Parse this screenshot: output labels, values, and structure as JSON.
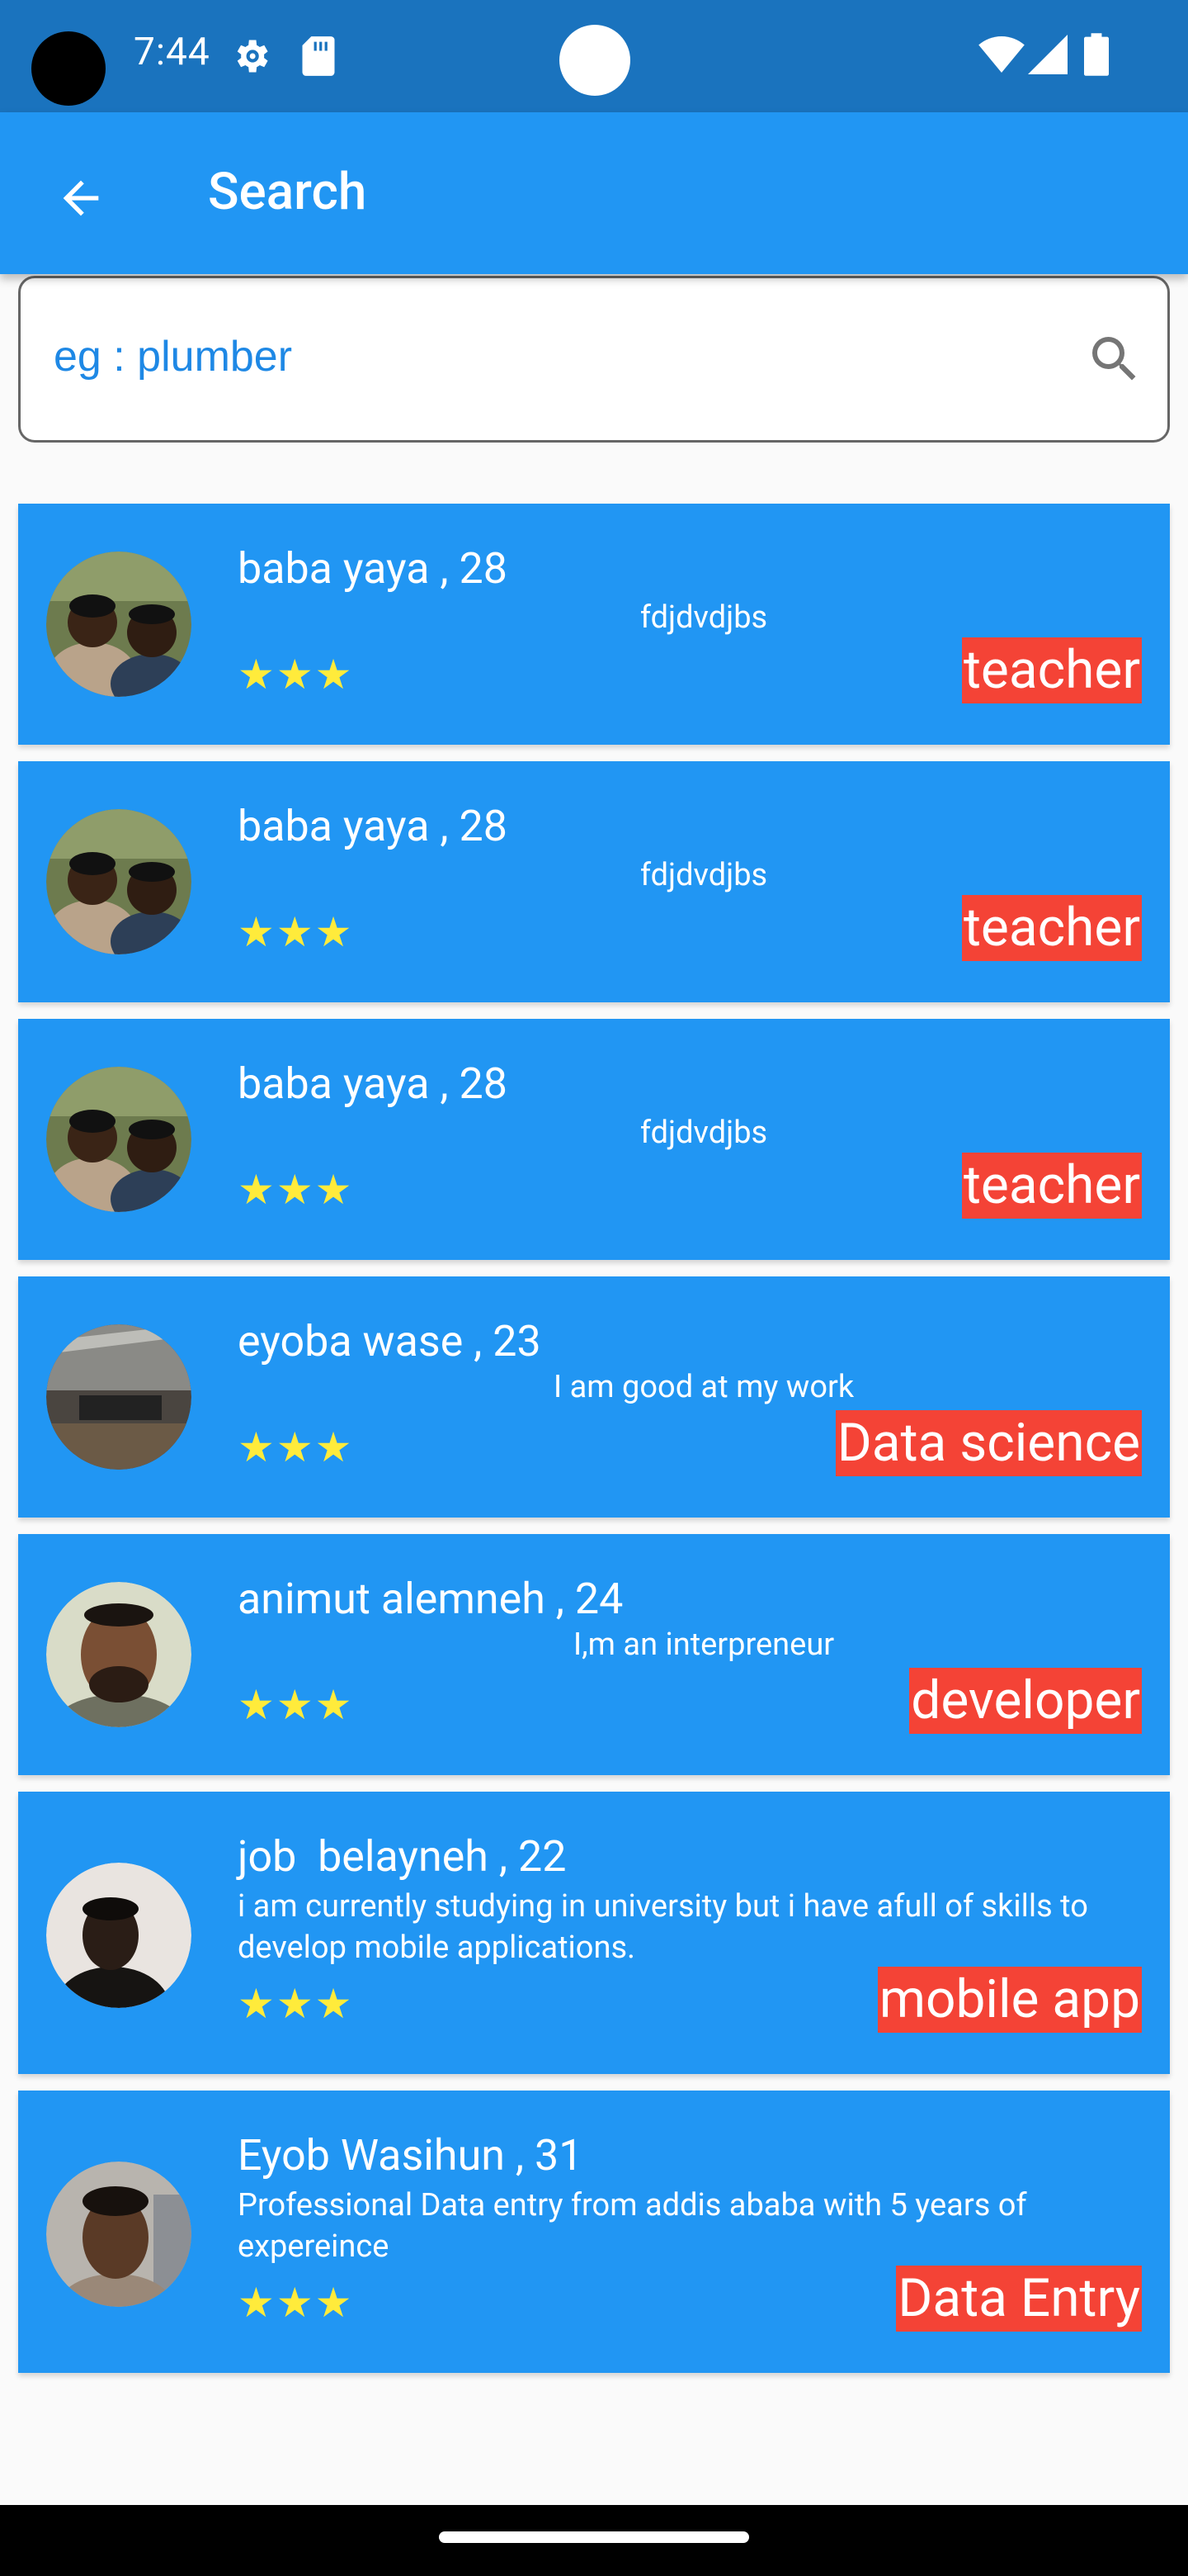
{
  "status_bar": {
    "time": "7:44",
    "icons": [
      "settings-icon",
      "sd-card-icon",
      "wifi-icon",
      "signal-icon",
      "battery-icon"
    ]
  },
  "app_bar": {
    "title": "Search",
    "back_icon": "arrow-back-icon"
  },
  "search": {
    "placeholder": "eg : plumber",
    "value": ""
  },
  "colors": {
    "status_bar": "#1a73be",
    "app_bar": "#2196f3",
    "card": "#2196f3",
    "tag": "#f44336",
    "stars": "#ffeb3b",
    "placeholder": "#1e88e5"
  },
  "results": [
    {
      "name": "baba yaya , 28",
      "description": "fdjdvdjbs",
      "rating": 3,
      "stars": "★★★",
      "profession": "teacher"
    },
    {
      "name": "baba yaya , 28",
      "description": "fdjdvdjbs",
      "rating": 3,
      "stars": "★★★",
      "profession": "teacher"
    },
    {
      "name": "baba yaya , 28",
      "description": "fdjdvdjbs",
      "rating": 3,
      "stars": "★★★",
      "profession": "teacher"
    },
    {
      "name": "eyoba wase , 23",
      "description": "I am good at my work",
      "rating": 3,
      "stars": "★★★",
      "profession": "Data science"
    },
    {
      "name": "animut alemneh , 24",
      "description": "I,m an interpreneur",
      "rating": 3,
      "stars": "★★★",
      "profession": "developer"
    },
    {
      "name": "job  belayneh , 22",
      "description": "i am currently studying in university but i have afull of skills to develop mobile applications.",
      "rating": 3,
      "stars": "★★★",
      "profession": "mobile app"
    },
    {
      "name": "Eyob Wasihun , 31",
      "description": "Professional Data entry from addis ababa with 5 years of expereince",
      "rating": 3,
      "stars": "★★★",
      "profession": "Data Entry"
    }
  ]
}
